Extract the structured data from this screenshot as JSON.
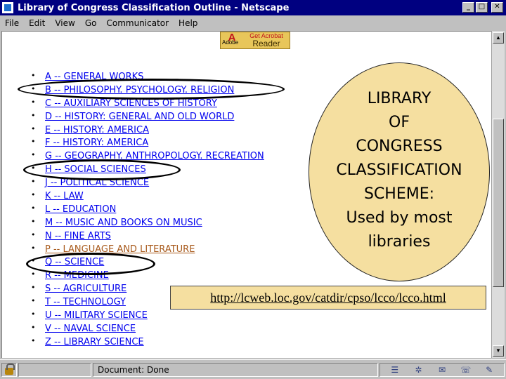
{
  "window": {
    "title": "Library of Congress Classification Outline - Netscape",
    "controls": {
      "minimize": "_",
      "maximize": "□",
      "close": "✕"
    }
  },
  "menu": [
    "File",
    "Edit",
    "View",
    "Go",
    "Communicator",
    "Help"
  ],
  "banner": {
    "top_text": "Get Acrobat",
    "main_text": "Reader",
    "logo_letter": "A",
    "brand": "Adobe"
  },
  "classes": [
    {
      "label": "A -- GENERAL WORKS",
      "visited": false
    },
    {
      "label": "B -- PHILOSOPHY. PSYCHOLOGY. RELIGION",
      "visited": false
    },
    {
      "label": "C -- AUXILIARY SCIENCES OF HISTORY",
      "visited": false
    },
    {
      "label": "D -- HISTORY: GENERAL AND OLD WORLD",
      "visited": false
    },
    {
      "label": "E -- HISTORY: AMERICA",
      "visited": false
    },
    {
      "label": "F -- HISTORY: AMERICA",
      "visited": false
    },
    {
      "label": "G -- GEOGRAPHY. ANTHROPOLOGY. RECREATION",
      "visited": false
    },
    {
      "label": "H -- SOCIAL SCIENCES",
      "visited": false
    },
    {
      "label": "J -- POLITICAL SCIENCE",
      "visited": false
    },
    {
      "label": "K -- LAW",
      "visited": false
    },
    {
      "label": "L -- EDUCATION",
      "visited": false
    },
    {
      "label": "M -- MUSIC AND BOOKS ON MUSIC",
      "visited": false
    },
    {
      "label": "N -- FINE ARTS",
      "visited": false
    },
    {
      "label": "P -- LANGUAGE AND LITERATURE",
      "visited": true
    },
    {
      "label": "Q -- SCIENCE",
      "visited": false
    },
    {
      "label": "R -- MEDICINE",
      "visited": false
    },
    {
      "label": "S -- AGRICULTURE",
      "visited": false
    },
    {
      "label": "T -- TECHNOLOGY",
      "visited": false
    },
    {
      "label": "U -- MILITARY SCIENCE",
      "visited": false
    },
    {
      "label": "V -- NAVAL SCIENCE",
      "visited": false
    },
    {
      "label": "Z -- LIBRARY SCIENCE",
      "visited": false
    }
  ],
  "callout": {
    "lines": [
      "LIBRARY",
      "OF",
      "CONGRESS",
      "CLASSIFICATION",
      "SCHEME:",
      "Used by most",
      "libraries"
    ]
  },
  "url": "http://lcweb.loc.gov/catdir/cpso/lcco/lcco.html",
  "status": {
    "text": "Document: Done"
  },
  "colors": {
    "link": "#0000ee",
    "visited_link": "#a85a1c",
    "titlebar": "#000080",
    "callout_fill": "#f5dfa0"
  },
  "icons": {
    "tray": [
      "component-bar-icon",
      "security-icon",
      "mail-icon",
      "discussion-icon",
      "composer-icon"
    ]
  }
}
